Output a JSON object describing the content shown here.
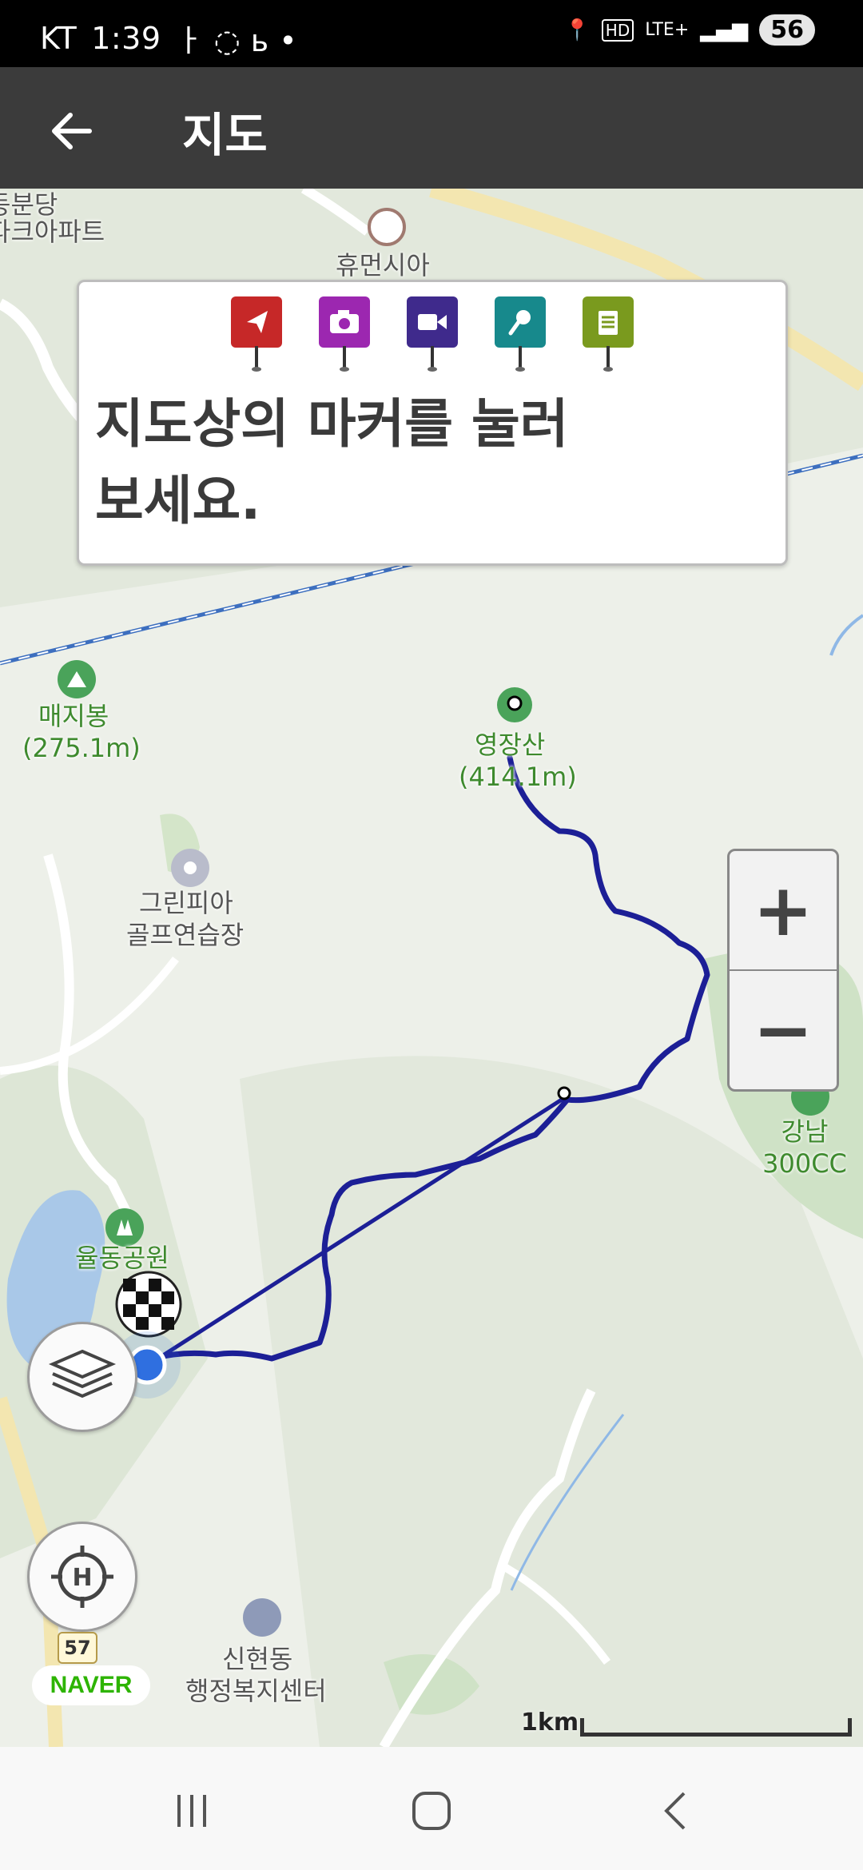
{
  "status_bar": {
    "carrier": "KT",
    "time": "1:39",
    "network": "LTE+",
    "battery": "56"
  },
  "app_bar": {
    "title": "지도"
  },
  "info_card": {
    "message": "지도상의 마커를 눌러 보세요.",
    "markers": [
      {
        "name": "location-marker",
        "icon": "navigation-arrow-icon",
        "color": "#c62828"
      },
      {
        "name": "photo-marker",
        "icon": "camera-icon",
        "color": "#9c27b0"
      },
      {
        "name": "video-marker",
        "icon": "video-camera-icon",
        "color": "#3f2a8c"
      },
      {
        "name": "audio-marker",
        "icon": "microphone-icon",
        "color": "#17898c"
      },
      {
        "name": "memo-marker",
        "icon": "notepad-icon",
        "color": "#7a9a1e"
      }
    ]
  },
  "map_labels": {
    "humansia": "휴먼시아",
    "dongbundang": "동분당",
    "park_apt": "파크아파트",
    "maejibong": "매지봉",
    "maejibong_elev": "(275.1m)",
    "yeongjangsan": "영장산",
    "yeongjangsan_elev": "(414.1m)",
    "greenpia_1": "그린피아",
    "greenpia_2": "골프연습장",
    "gangnam300": "강남300CC",
    "yuldong_park": "율동공원",
    "sinhyeon_1": "신현동",
    "sinhyeon_2": "행정복지센터"
  },
  "zoom": {
    "in_label": "+",
    "out_label": "−"
  },
  "road_number": "57",
  "naver_logo": "NAVER",
  "scale": {
    "label": "1km"
  },
  "colors": {
    "track": "#1c1f96",
    "app_bar": "#3b3b3b",
    "location": "#2f6fe0"
  }
}
